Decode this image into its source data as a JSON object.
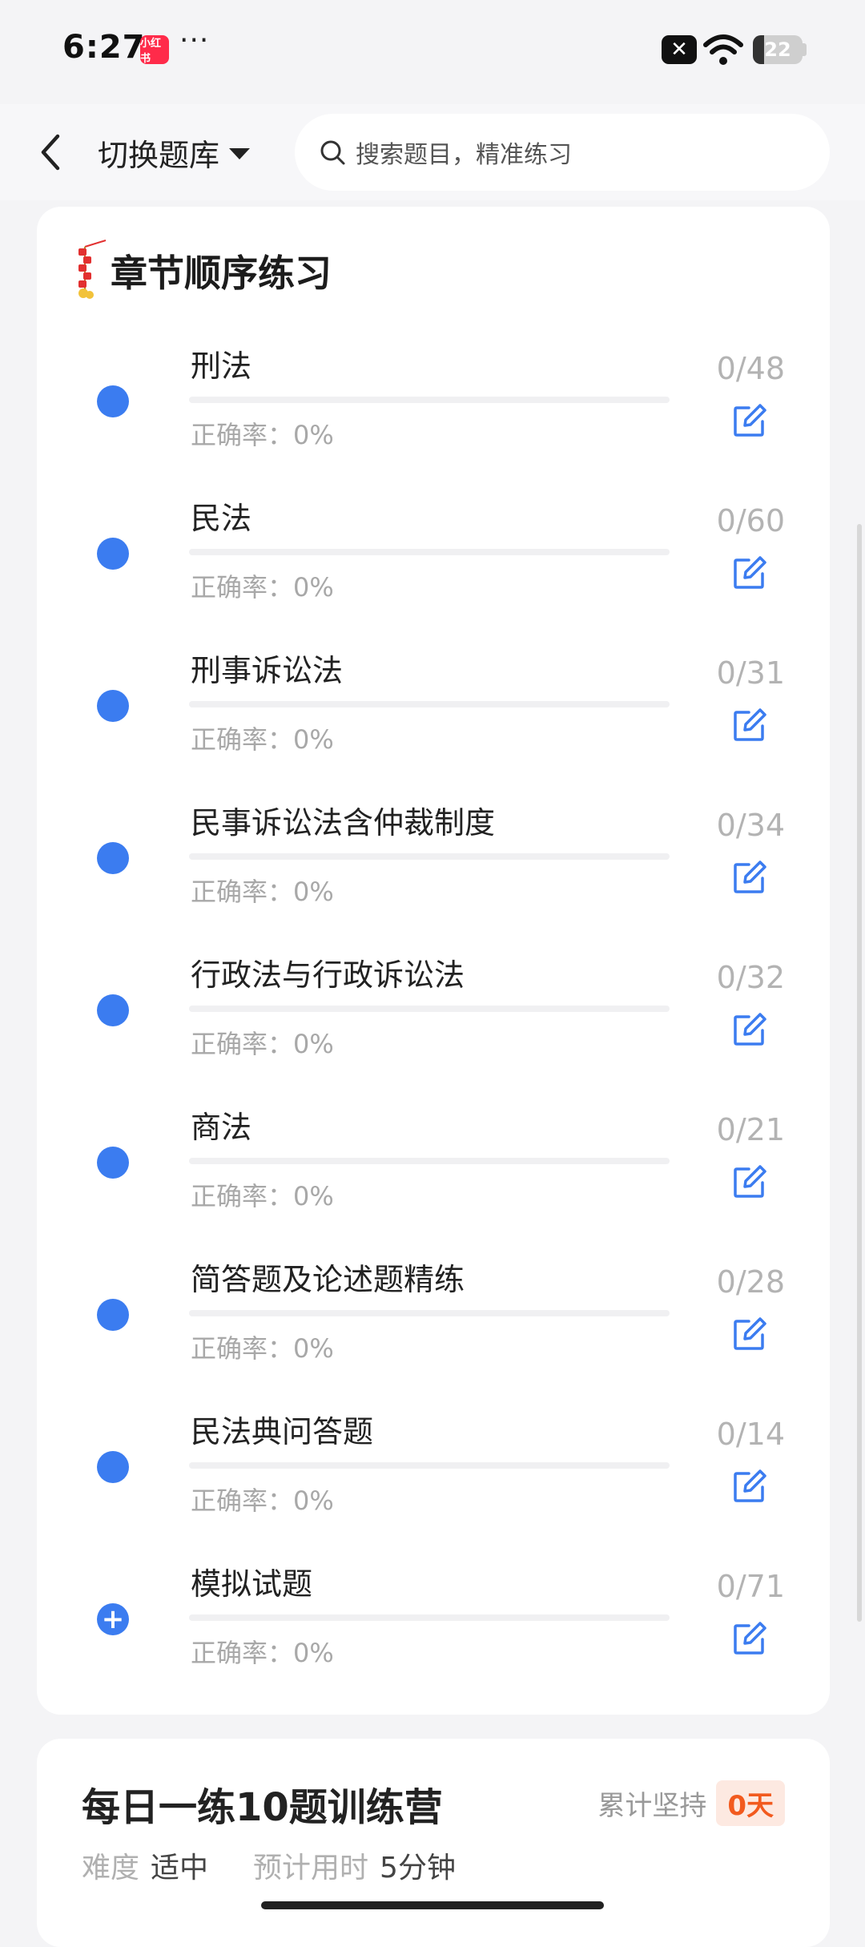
{
  "status_bar": {
    "time": "6:27",
    "app_badge": "小红书",
    "more": "···",
    "battery": "22"
  },
  "header": {
    "switch_label": "切换题库",
    "search_placeholder": "搜索题目，精准练习"
  },
  "chapter_card": {
    "title": "章节顺序练习",
    "items": [
      {
        "name": "刑法",
        "accuracy": "正确率：0%",
        "count": "0/48",
        "progress": 0,
        "icon": "dot"
      },
      {
        "name": "民法",
        "accuracy": "正确率：0%",
        "count": "0/60",
        "progress": 0,
        "icon": "dot"
      },
      {
        "name": "刑事诉讼法",
        "accuracy": "正确率：0%",
        "count": "0/31",
        "progress": 0,
        "icon": "dot"
      },
      {
        "name": "民事诉讼法含仲裁制度",
        "accuracy": "正确率：0%",
        "count": "0/34",
        "progress": 0,
        "icon": "dot"
      },
      {
        "name": "行政法与行政诉讼法",
        "accuracy": "正确率：0%",
        "count": "0/32",
        "progress": 0,
        "icon": "dot"
      },
      {
        "name": "商法",
        "accuracy": "正确率：0%",
        "count": "0/21",
        "progress": 0,
        "icon": "dot"
      },
      {
        "name": "简答题及论述题精练",
        "accuracy": "正确率：0%",
        "count": "0/28",
        "progress": 0,
        "icon": "dot"
      },
      {
        "name": "民法典问答题",
        "accuracy": "正确率：0%",
        "count": "0/14",
        "progress": 0,
        "icon": "dot"
      },
      {
        "name": "模拟试题",
        "accuracy": "正确率：0%",
        "count": "0/71",
        "progress": 0,
        "icon": "plus",
        "plus_glyph": "+"
      }
    ]
  },
  "daily_card": {
    "title": "每日一练10题训练营",
    "persist_label": "累计坚持",
    "persist_days": "0天",
    "difficulty_label": "难度",
    "difficulty_value": "适中",
    "time_label": "预计用时",
    "time_value": "5分钟"
  },
  "colors": {
    "accent": "#3b7cf0",
    "badge_text": "#f25a1e",
    "badge_bg": "#fde9e1"
  }
}
